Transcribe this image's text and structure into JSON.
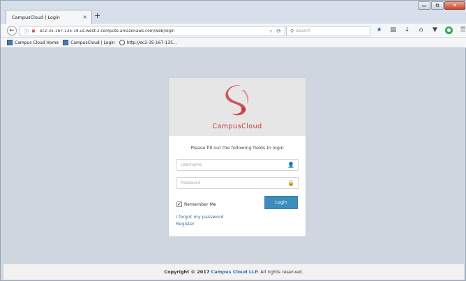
{
  "browser": {
    "tab_title": "CampusCloud | Login",
    "tab_close": "×",
    "new_tab": "+",
    "window_controls": [
      "▭",
      "⧉",
      "✕"
    ],
    "url": "ec2-35-167-135-19.us-west-2.compute.amazonaws.com/web/login",
    "search_placeholder": "Search",
    "bookmarks": [
      {
        "label": "Campus Cloud Home",
        "icon": "page-icon"
      },
      {
        "label": "CampusCloud | Login",
        "icon": "page-icon"
      },
      {
        "label": "http://ec2-35-167-135...",
        "icon": "globe-icon"
      }
    ]
  },
  "login": {
    "brand": "CampusCloud",
    "prompt": "Please fill out the following fields to login",
    "username_placeholder": "Username",
    "password_placeholder": "Password",
    "remember_label": "Remember Me",
    "remember_checked": true,
    "button_label": "Login",
    "forgot_label": "I forgot my password",
    "register_label": "Register"
  },
  "footer": {
    "prefix": "Copyright © 2017",
    "company": "Campus Cloud LLP.",
    "suffix": "All rights reserved."
  },
  "colors": {
    "brand_red": "#c8383d",
    "button_blue": "#3c8dbc",
    "link_blue": "#3c6ea8",
    "page_bg": "#cfd6e0"
  }
}
